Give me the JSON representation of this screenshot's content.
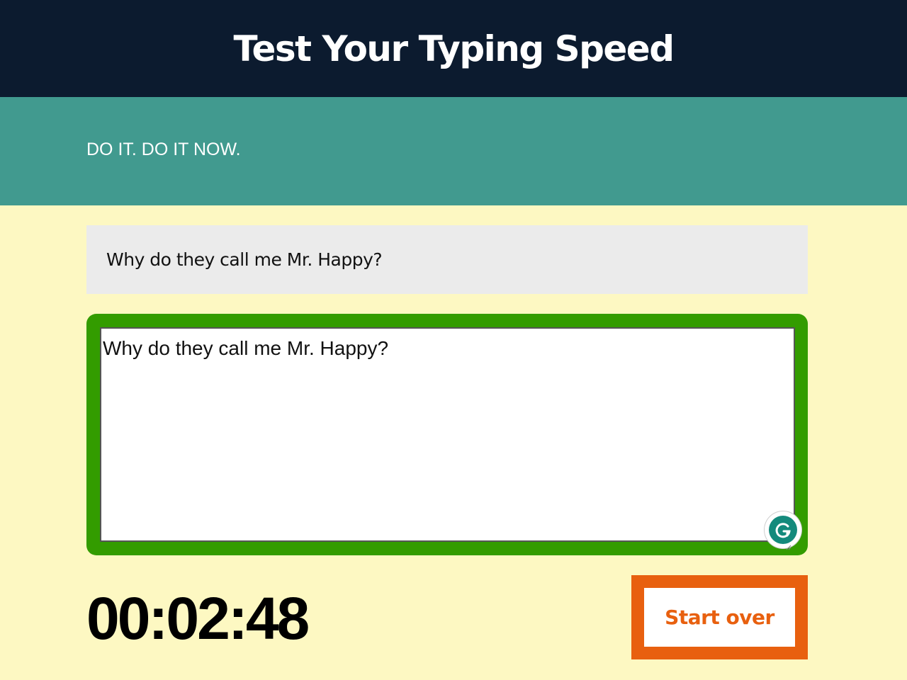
{
  "header": {
    "title": "Test Your Typing Speed"
  },
  "intro": {
    "text": "DO IT. DO IT NOW."
  },
  "origin": {
    "text": "Why do they call me Mr. Happy?"
  },
  "test_area": {
    "value": "Why do they call me Mr. Happy?",
    "border_color": "#339c00"
  },
  "grammarly": {
    "icon": "grammarly-icon",
    "color": "#148a7c"
  },
  "timer": {
    "value": "00:02:48"
  },
  "reset_button": {
    "label": "Start over",
    "color": "#e8600f"
  },
  "colors": {
    "header_bg": "#0c1b2f",
    "intro_bg": "#419a8f",
    "page_bg": "#fdf8c2",
    "origin_bg": "#ebebeb"
  }
}
